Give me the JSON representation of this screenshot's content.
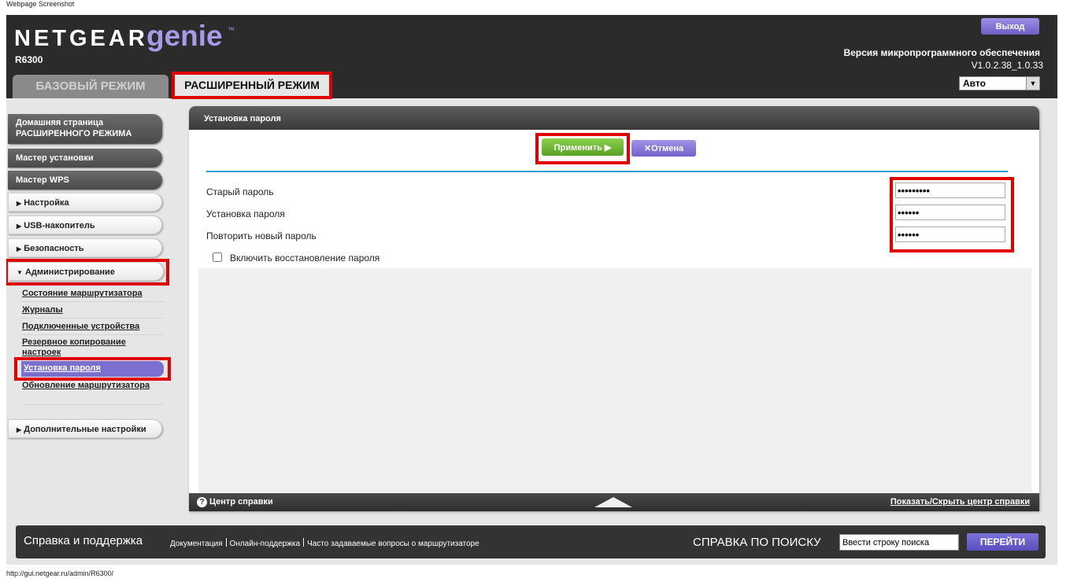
{
  "caption": "Webpage Screenshot",
  "status_url": "http://gui.netgear.ru/admin/R6300/",
  "header": {
    "brand": "NETGEAR",
    "product": "genie",
    "tm": "™",
    "model": "R6300",
    "logout": "Выход",
    "firmware_label": "Версия микропрограммного обеспечения",
    "firmware_version": "V1.0.2.38_1.0.33",
    "language": "Авто",
    "tab_basic": "БАЗОВЫЙ РЕЖИМ",
    "tab_advanced": "РАСШИРЕННЫЙ РЕЖИМ"
  },
  "sidebar": {
    "home_line1": "Домашняя страница",
    "home_line2": "РАСШИРЕННОГО РЕЖИМА",
    "setup_wizard": "Мастер установки",
    "wps_wizard": "Мастер WPS",
    "setup": "Настройка",
    "usb": "USB-накопитель",
    "security": "Безопасность",
    "admin": "Администрирование",
    "admin_items": [
      "Состояние маршрутизатора",
      "Журналы",
      "Подключенные устройства",
      "Резервное копирование настроек",
      "Установка пароля",
      "Обновление маршрутизатора"
    ],
    "advanced_settings": "Дополнительные настройки",
    "arrow_right": "▶",
    "arrow_down": "▼"
  },
  "panel": {
    "title": "Установка пароля",
    "apply": "Применить ▶",
    "cancel": "✕Отмена",
    "old_password_label": "Старый пароль",
    "new_password_label": "Установка пароля",
    "repeat_password_label": "Повторить новый пароль",
    "old_password_value": "•••••••••",
    "new_password_value": "••••••",
    "repeat_password_value": "••••••",
    "recovery_label": "Включить восстановление пароля",
    "recovery_checked": false,
    "help_icon": "?",
    "help_title": "Центр справки",
    "help_toggle": "Показать/Скрыть центр справки"
  },
  "footer": {
    "title": "Справка и поддержка",
    "links": [
      "Документация",
      "Онлайн-поддержка",
      "Часто задаваемые вопросы о маршрутизаторе"
    ],
    "search_title": "СПРАВКА ПО ПОИСКУ",
    "search_value": "Ввести строку поиска",
    "go": "ПЕРЕЙТИ"
  }
}
